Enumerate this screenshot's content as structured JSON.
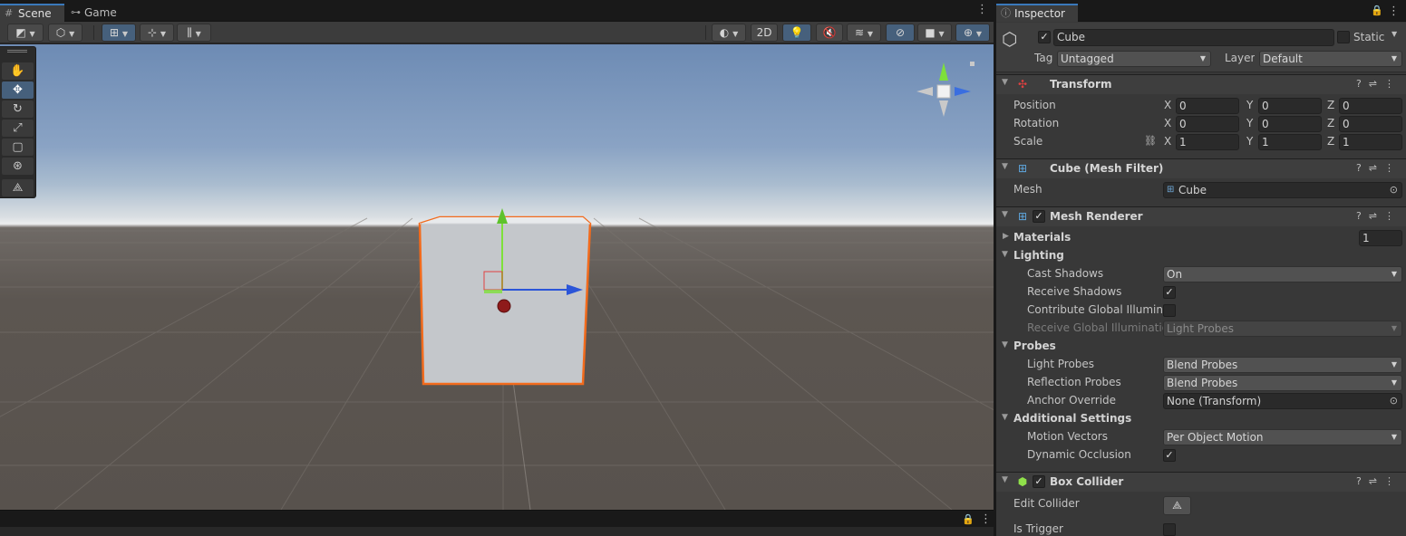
{
  "scene": {
    "tabs": [
      {
        "label": "Scene",
        "icon": "grid-icon"
      },
      {
        "label": "Game",
        "icon": "gamepad-icon"
      }
    ],
    "toolbar": {
      "mode_2d_label": "2D"
    }
  },
  "inspector": {
    "tab_label": "Inspector",
    "object": {
      "name": "Cube",
      "active": true,
      "static_label": "Static",
      "tag_label": "Tag",
      "tag_value": "Untagged",
      "layer_label": "Layer",
      "layer_value": "Default"
    },
    "transform": {
      "title": "Transform",
      "position_label": "Position",
      "rotation_label": "Rotation",
      "scale_label": "Scale",
      "axis_labels": [
        "X",
        "Y",
        "Z"
      ],
      "position": [
        "0",
        "0",
        "0"
      ],
      "rotation": [
        "0",
        "0",
        "0"
      ],
      "scale": [
        "1",
        "1",
        "1"
      ]
    },
    "mesh_filter": {
      "title": "Cube (Mesh Filter)",
      "mesh_label": "Mesh",
      "mesh_value": "Cube"
    },
    "mesh_renderer": {
      "title": "Mesh Renderer",
      "materials_label": "Materials",
      "materials_count": "1",
      "lighting_label": "Lighting",
      "cast_shadows_label": "Cast Shadows",
      "cast_shadows_value": "On",
      "receive_shadows_label": "Receive Shadows",
      "contribute_gi_label": "Contribute Global Illuminat",
      "receive_gi_label": "Receive Global Illumination",
      "receive_gi_value": "Light Probes",
      "probes_label": "Probes",
      "light_probes_label": "Light Probes",
      "light_probes_value": "Blend Probes",
      "reflection_probes_label": "Reflection Probes",
      "reflection_probes_value": "Blend Probes",
      "anchor_override_label": "Anchor Override",
      "anchor_override_value": "None (Transform)",
      "additional_settings_label": "Additional Settings",
      "motion_vectors_label": "Motion Vectors",
      "motion_vectors_value": "Per Object Motion",
      "dynamic_occlusion_label": "Dynamic Occlusion"
    },
    "box_collider": {
      "title": "Box Collider",
      "edit_collider_label": "Edit Collider",
      "is_trigger_label": "Is Trigger"
    }
  },
  "colors": {
    "selection_outline": "#f26b1d",
    "axis_y": "#7ee03a",
    "axis_x_handle": "#2b55d8",
    "active_tool": "#46607c"
  }
}
